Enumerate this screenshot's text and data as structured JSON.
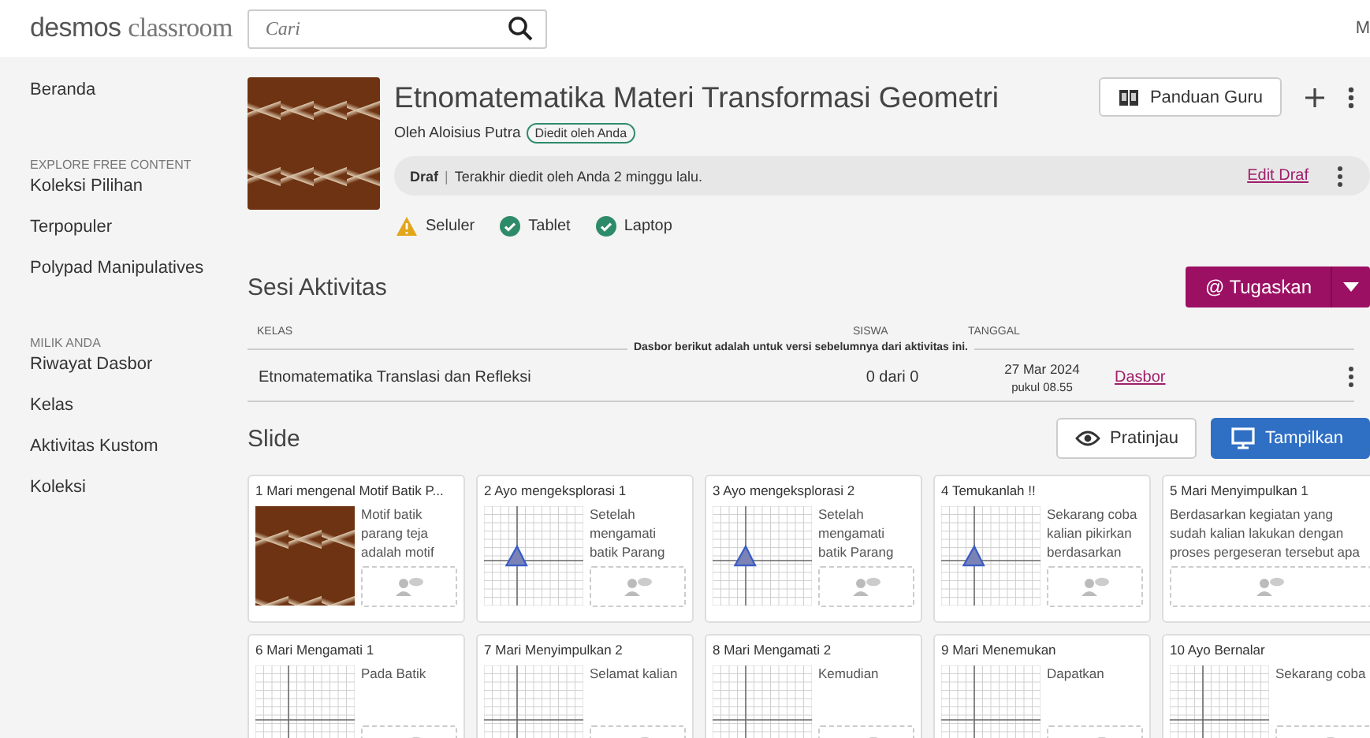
{
  "header": {
    "logo_bold": "desmos",
    "logo_light": "classroom",
    "search": {
      "placeholder": "Cari"
    },
    "account_initial": "M"
  },
  "sidebar": {
    "items": [
      {
        "label": "Beranda",
        "kind": "link"
      },
      {
        "label": "EXPLORE FREE CONTENT",
        "kind": "heading"
      },
      {
        "label": "Koleksi Pilihan",
        "kind": "link"
      },
      {
        "label": "Terpopuler",
        "kind": "link"
      },
      {
        "label": "Polypad Manipulatives",
        "kind": "link"
      },
      {
        "label": "MILIK ANDA",
        "kind": "heading"
      },
      {
        "label": "Riwayat Dasbor",
        "kind": "link"
      },
      {
        "label": "Kelas",
        "kind": "link"
      },
      {
        "label": "Aktivitas Kustom",
        "kind": "link"
      },
      {
        "label": "Koleksi",
        "kind": "link"
      }
    ]
  },
  "activity": {
    "title": "Etnomatematika Materi Transformasi Geometri",
    "author": "Oleh Aloisius Putra",
    "badge": "Diedit oleh Anda",
    "guide_button": "Panduan Guru",
    "draft": {
      "label": "Draf",
      "separator": "|",
      "text": "Terakhir diedit oleh Anda 2 minggu lalu.",
      "link": "Edit Draf"
    },
    "devices": [
      {
        "label": "Seluler",
        "kind": "warning"
      },
      {
        "label": "Tablet",
        "kind": "ok"
      },
      {
        "label": "Laptop",
        "kind": "ok"
      }
    ]
  },
  "sessions": {
    "title": "Sesi Aktivitas",
    "assign_button": "Tugaskan",
    "assign_icon": "@",
    "columns": [
      "KELAS",
      "SISWA",
      "TANGGAL"
    ],
    "notice": "Dasbor berikut adalah untuk versi sebelumnya dari aktivitas ini.",
    "rows": [
      {
        "class": "Etnomatematika Translasi dan Refleksi",
        "students": "0 dari 0",
        "date": "27 Mar 2024",
        "time": "pukul 08.55",
        "link": "Dasbor"
      }
    ]
  },
  "slides": {
    "title": "Slide",
    "preview_button": "Pratinjau",
    "present_button": "Tampilkan",
    "cards": [
      {
        "number": "1",
        "title": "Mari mengenal Motif Batik P...",
        "kind": "batik",
        "text": "Motif batik parang teja adalah motif"
      },
      {
        "number": "2",
        "title": "Ayo mengeksplorasi 1",
        "kind": "graph",
        "text": "Setelah mengamati batik Parang"
      },
      {
        "number": "3",
        "title": "Ayo mengeksplorasi 2",
        "kind": "graph",
        "text": "Setelah mengamati batik Parang"
      },
      {
        "number": "4",
        "title": "Temukanlah !!",
        "kind": "graph",
        "text": "Sekarang coba kalian pikirkan berdasarkan"
      },
      {
        "number": "5",
        "title": "Mari Menyimpulkan 1",
        "kind": "text",
        "text": "Berdasarkan kegiatan yang sudah kalian lakukan dengan proses pergeseran tersebut apa"
      },
      {
        "number": "6",
        "title": "Mari Mengamati 1",
        "kind": "grid",
        "text": "Pada Batik"
      },
      {
        "number": "7",
        "title": "Mari Menyimpulkan 2",
        "kind": "grid",
        "text": "Selamat kalian"
      },
      {
        "number": "8",
        "title": "Mari Mengamati 2",
        "kind": "grid",
        "text": "Kemudian"
      },
      {
        "number": "9",
        "title": "Mari Menemukan",
        "kind": "grid",
        "text": "Dapatkan"
      },
      {
        "number": "10",
        "title": "Ayo Bernalar",
        "kind": "grid",
        "text": "Sekarang coba"
      }
    ]
  }
}
